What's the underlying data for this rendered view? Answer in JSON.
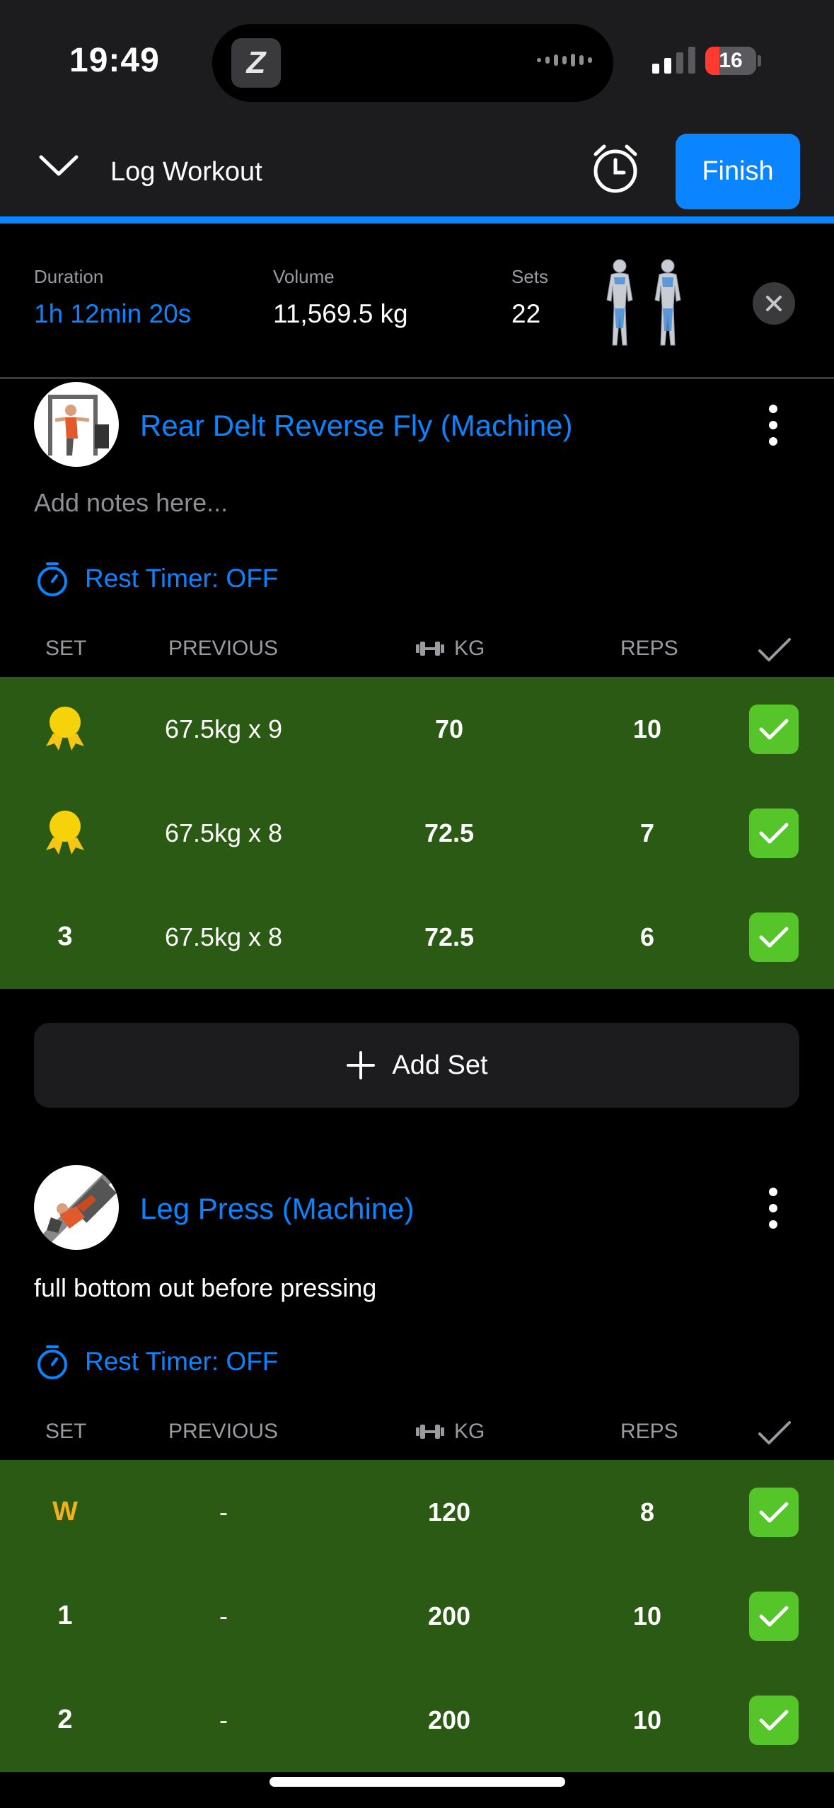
{
  "status": {
    "time": "19:49",
    "battery": "16"
  },
  "header": {
    "title": "Log Workout",
    "finish_label": "Finish"
  },
  "summary": {
    "duration_label": "Duration",
    "duration_value": "1h 12min 20s",
    "volume_label": "Volume",
    "volume_value": "11,569.5 kg",
    "sets_label": "Sets",
    "sets_value": "22"
  },
  "columns": {
    "set": "SET",
    "previous": "PREVIOUS",
    "kg": "KG",
    "reps": "REPS"
  },
  "exercises": [
    {
      "name": "Rear Delt Reverse Fly (Machine)",
      "note": "Add notes here...",
      "rest_timer": "Rest Timer: OFF",
      "sets": [
        {
          "set": "",
          "previous": "67.5kg x 9",
          "kg": "70",
          "reps": "10",
          "medal": true
        },
        {
          "set": "",
          "previous": "67.5kg x 8",
          "kg": "72.5",
          "reps": "7",
          "medal": true
        },
        {
          "set": "3",
          "previous": "67.5kg x 8",
          "kg": "72.5",
          "reps": "6",
          "medal": false
        }
      ],
      "add_set_label": "Add Set"
    },
    {
      "name": "Leg Press (Machine)",
      "note": "full bottom out before pressing",
      "rest_timer": "Rest Timer: OFF",
      "sets": [
        {
          "set": "W",
          "previous": "-",
          "kg": "120",
          "reps": "8"
        },
        {
          "set": "1",
          "previous": "-",
          "kg": "200",
          "reps": "10"
        },
        {
          "set": "2",
          "previous": "-",
          "kg": "200",
          "reps": "10"
        }
      ]
    }
  ],
  "colors": {
    "accent": "#0a84ff",
    "completed_row": "#2b5a14",
    "check": "#55c52a",
    "warmup": "#f0b020"
  }
}
